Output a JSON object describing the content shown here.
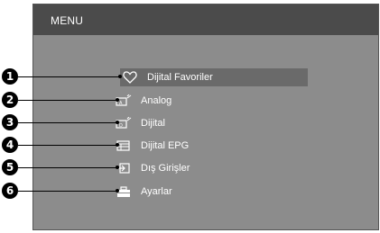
{
  "menu": {
    "title": "MENU",
    "items": [
      {
        "number": "1",
        "label": "Dijital Favoriler",
        "icon": "heart-icon"
      },
      {
        "number": "2",
        "label": "Analog",
        "icon": "analog-tv-icon"
      },
      {
        "number": "3",
        "label": "Dijital",
        "icon": "digital-tv-icon"
      },
      {
        "number": "4",
        "label": "Dijital EPG",
        "icon": "epg-icon"
      },
      {
        "number": "5",
        "label": "Dış Girişler",
        "icon": "external-input-icon"
      },
      {
        "number": "6",
        "label": "Ayarlar",
        "icon": "toolbox-icon"
      }
    ]
  }
}
